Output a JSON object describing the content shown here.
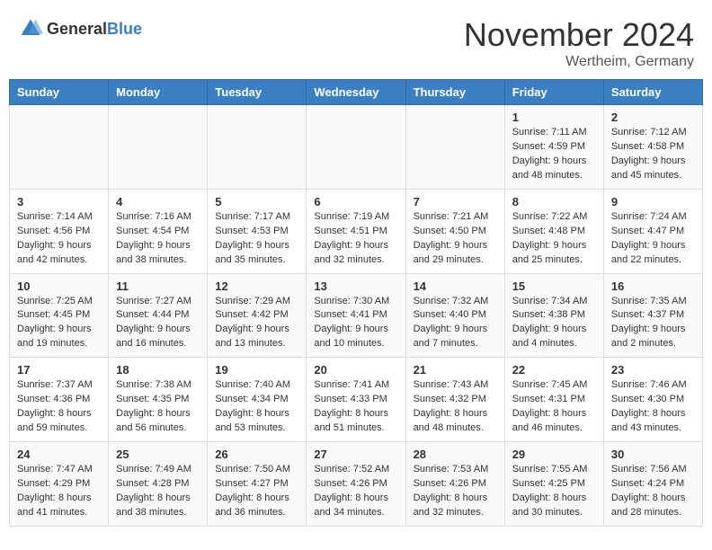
{
  "header": {
    "logo_general": "General",
    "logo_blue": "Blue",
    "month_title": "November 2024",
    "subtitle": "Wertheim, Germany"
  },
  "weekdays": [
    "Sunday",
    "Monday",
    "Tuesday",
    "Wednesday",
    "Thursday",
    "Friday",
    "Saturday"
  ],
  "weeks": [
    [
      {
        "day": "",
        "info": ""
      },
      {
        "day": "",
        "info": ""
      },
      {
        "day": "",
        "info": ""
      },
      {
        "day": "",
        "info": ""
      },
      {
        "day": "",
        "info": ""
      },
      {
        "day": "1",
        "info": "Sunrise: 7:11 AM\nSunset: 4:59 PM\nDaylight: 9 hours and 48 minutes."
      },
      {
        "day": "2",
        "info": "Sunrise: 7:12 AM\nSunset: 4:58 PM\nDaylight: 9 hours and 45 minutes."
      }
    ],
    [
      {
        "day": "3",
        "info": "Sunrise: 7:14 AM\nSunset: 4:56 PM\nDaylight: 9 hours and 42 minutes."
      },
      {
        "day": "4",
        "info": "Sunrise: 7:16 AM\nSunset: 4:54 PM\nDaylight: 9 hours and 38 minutes."
      },
      {
        "day": "5",
        "info": "Sunrise: 7:17 AM\nSunset: 4:53 PM\nDaylight: 9 hours and 35 minutes."
      },
      {
        "day": "6",
        "info": "Sunrise: 7:19 AM\nSunset: 4:51 PM\nDaylight: 9 hours and 32 minutes."
      },
      {
        "day": "7",
        "info": "Sunrise: 7:21 AM\nSunset: 4:50 PM\nDaylight: 9 hours and 29 minutes."
      },
      {
        "day": "8",
        "info": "Sunrise: 7:22 AM\nSunset: 4:48 PM\nDaylight: 9 hours and 25 minutes."
      },
      {
        "day": "9",
        "info": "Sunrise: 7:24 AM\nSunset: 4:47 PM\nDaylight: 9 hours and 22 minutes."
      }
    ],
    [
      {
        "day": "10",
        "info": "Sunrise: 7:25 AM\nSunset: 4:45 PM\nDaylight: 9 hours and 19 minutes."
      },
      {
        "day": "11",
        "info": "Sunrise: 7:27 AM\nSunset: 4:44 PM\nDaylight: 9 hours and 16 minutes."
      },
      {
        "day": "12",
        "info": "Sunrise: 7:29 AM\nSunset: 4:42 PM\nDaylight: 9 hours and 13 minutes."
      },
      {
        "day": "13",
        "info": "Sunrise: 7:30 AM\nSunset: 4:41 PM\nDaylight: 9 hours and 10 minutes."
      },
      {
        "day": "14",
        "info": "Sunrise: 7:32 AM\nSunset: 4:40 PM\nDaylight: 9 hours and 7 minutes."
      },
      {
        "day": "15",
        "info": "Sunrise: 7:34 AM\nSunset: 4:38 PM\nDaylight: 9 hours and 4 minutes."
      },
      {
        "day": "16",
        "info": "Sunrise: 7:35 AM\nSunset: 4:37 PM\nDaylight: 9 hours and 2 minutes."
      }
    ],
    [
      {
        "day": "17",
        "info": "Sunrise: 7:37 AM\nSunset: 4:36 PM\nDaylight: 8 hours and 59 minutes."
      },
      {
        "day": "18",
        "info": "Sunrise: 7:38 AM\nSunset: 4:35 PM\nDaylight: 8 hours and 56 minutes."
      },
      {
        "day": "19",
        "info": "Sunrise: 7:40 AM\nSunset: 4:34 PM\nDaylight: 8 hours and 53 minutes."
      },
      {
        "day": "20",
        "info": "Sunrise: 7:41 AM\nSunset: 4:33 PM\nDaylight: 8 hours and 51 minutes."
      },
      {
        "day": "21",
        "info": "Sunrise: 7:43 AM\nSunset: 4:32 PM\nDaylight: 8 hours and 48 minutes."
      },
      {
        "day": "22",
        "info": "Sunrise: 7:45 AM\nSunset: 4:31 PM\nDaylight: 8 hours and 46 minutes."
      },
      {
        "day": "23",
        "info": "Sunrise: 7:46 AM\nSunset: 4:30 PM\nDaylight: 8 hours and 43 minutes."
      }
    ],
    [
      {
        "day": "24",
        "info": "Sunrise: 7:47 AM\nSunset: 4:29 PM\nDaylight: 8 hours and 41 minutes."
      },
      {
        "day": "25",
        "info": "Sunrise: 7:49 AM\nSunset: 4:28 PM\nDaylight: 8 hours and 38 minutes."
      },
      {
        "day": "26",
        "info": "Sunrise: 7:50 AM\nSunset: 4:27 PM\nDaylight: 8 hours and 36 minutes."
      },
      {
        "day": "27",
        "info": "Sunrise: 7:52 AM\nSunset: 4:26 PM\nDaylight: 8 hours and 34 minutes."
      },
      {
        "day": "28",
        "info": "Sunrise: 7:53 AM\nSunset: 4:26 PM\nDaylight: 8 hours and 32 minutes."
      },
      {
        "day": "29",
        "info": "Sunrise: 7:55 AM\nSunset: 4:25 PM\nDaylight: 8 hours and 30 minutes."
      },
      {
        "day": "30",
        "info": "Sunrise: 7:56 AM\nSunset: 4:24 PM\nDaylight: 8 hours and 28 minutes."
      }
    ]
  ]
}
